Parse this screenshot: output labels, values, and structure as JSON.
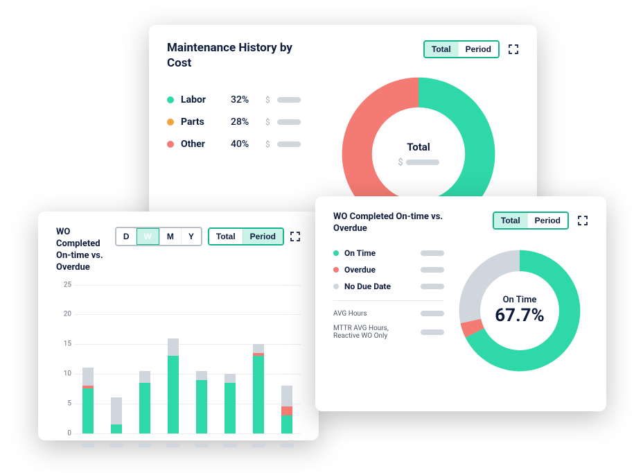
{
  "colors": {
    "teal": "#2fd8a8",
    "coral": "#f47b73",
    "amber": "#f2a33c",
    "gray": "#cfd6de",
    "darkgray": "#9aa3ae"
  },
  "maint": {
    "title": "Maintenance History by Cost",
    "toggle": {
      "a": "Total",
      "b": "Period",
      "active": "a"
    },
    "legend": [
      {
        "label": "Labor",
        "pct": "32%",
        "color": "#2fd8a8"
      },
      {
        "label": "Parts",
        "pct": "28%",
        "color": "#f2a33c"
      },
      {
        "label": "Other",
        "pct": "40%",
        "color": "#f47b73"
      }
    ],
    "center_label": "Total",
    "center_prefix": "$"
  },
  "bar": {
    "title": "WO Completed On-time vs. Overdue",
    "range": {
      "opts": [
        "D",
        "W",
        "M",
        "Y"
      ],
      "active": "W"
    },
    "toggle": {
      "a": "Total",
      "b": "Period",
      "active": "b"
    },
    "y_ticks": [
      0,
      5,
      10,
      15,
      20,
      25
    ]
  },
  "donut": {
    "title": "WO Completed On-time vs. Overdue",
    "toggle": {
      "a": "Total",
      "b": "Period",
      "active": "a"
    },
    "legend": [
      {
        "label": "On Time",
        "color": "#2fd8a8"
      },
      {
        "label": "Overdue",
        "color": "#f47b73"
      },
      {
        "label": "No Due Date",
        "color": "#cfd6de"
      }
    ],
    "sub": [
      {
        "label": "AVG Hours"
      },
      {
        "label": "MTTR AVG Hours, Reactive WO Only"
      }
    ],
    "center_label": "On Time",
    "center_value": "67.7%"
  },
  "chart_data": [
    {
      "type": "pie",
      "title": "Maintenance History by Cost",
      "series": [
        {
          "name": "Labor",
          "value": 32,
          "color": "#2fd8a8"
        },
        {
          "name": "Parts",
          "value": 28,
          "color": "#f2a33c"
        },
        {
          "name": "Other",
          "value": 40,
          "color": "#f47b73"
        }
      ]
    },
    {
      "type": "bar",
      "title": "WO Completed On-time vs. Overdue",
      "stacked": true,
      "ylim": [
        0,
        25
      ],
      "categories": [
        "",
        "",
        "",
        "",
        "",
        "",
        "",
        ""
      ],
      "series": [
        {
          "name": "On Time",
          "color": "#2fd8a8",
          "values": [
            7.5,
            1.5,
            8.5,
            13,
            9,
            8.5,
            13,
            3
          ]
        },
        {
          "name": "Overdue",
          "color": "#f47b73",
          "values": [
            0.5,
            0,
            0,
            0,
            0,
            0,
            0.5,
            1.5
          ]
        },
        {
          "name": "No Due Date",
          "color": "#cfd6de",
          "values": [
            3,
            4.5,
            2,
            3,
            1.5,
            1.5,
            1.5,
            3.5
          ]
        }
      ]
    },
    {
      "type": "pie",
      "title": "WO Completed On-time vs. Overdue",
      "series": [
        {
          "name": "On Time",
          "value": 67.7,
          "color": "#2fd8a8"
        },
        {
          "name": "Overdue",
          "value": 4.0,
          "color": "#f47b73"
        },
        {
          "name": "No Due Date",
          "value": 28.3,
          "color": "#cfd6de"
        }
      ],
      "center": {
        "label": "On Time",
        "value": "67.7%"
      }
    }
  ]
}
